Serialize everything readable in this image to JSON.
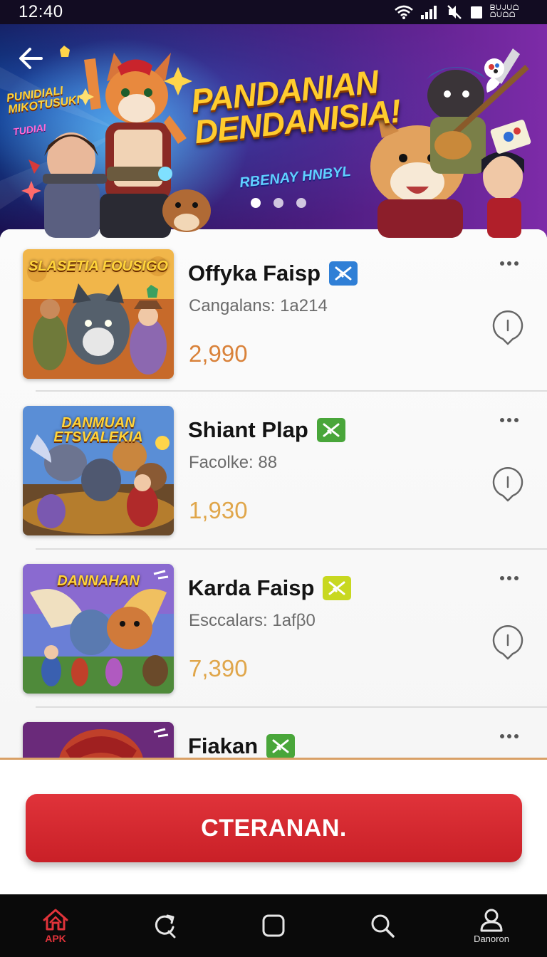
{
  "status_bar": {
    "time": "12:40",
    "indicator_text": "ᗷᑌᒍᑌᗝ ᗝᑌᗝᗝ",
    "icons": [
      "wifi-icon",
      "signal-icon",
      "mute-icon",
      "battery-icon"
    ]
  },
  "hero": {
    "title": "PANDANIAN DENDANISIA!",
    "subtitle": "RBENAY HNBYL",
    "tag_left": "PUNIDIALI MIKOTUSUKI",
    "tag_left_2": "TUDIAI",
    "page_count": 3,
    "active_page": 1,
    "back_icon": "back-arrow-icon",
    "corner_icon": "brush-icon"
  },
  "items": [
    {
      "name": "Offyka Faisp",
      "meta": "Cangalans: 1a214",
      "price": "2,990",
      "thumb_label": "SLASETIA FOUSIGO",
      "badge_color": "#2f7fd6",
      "price_color": "#d9823a"
    },
    {
      "name": "Shiant Plap",
      "meta": "Facolke: 88",
      "price": "1,930",
      "thumb_label": "DANMUAN ETSVALEKIA",
      "badge_color": "#49a63a",
      "price_color": "#e0a64a"
    },
    {
      "name": "Karda Faisp",
      "meta": "Esccalars: 1afβ0",
      "price": "7,390",
      "thumb_label": "DANNAHAN",
      "badge_color": "#c8d820",
      "price_color": "#e0a64a"
    },
    {
      "name": "Fiakan",
      "meta": "",
      "price": "",
      "thumb_label": "",
      "badge_color": "#49a63a",
      "price_color": "#e0a64a"
    }
  ],
  "cta": {
    "label": "CTERANAN."
  },
  "nav": [
    {
      "label": "APK",
      "icon": "home-icon",
      "active": true
    },
    {
      "label": "",
      "icon": "refresh-icon",
      "active": false
    },
    {
      "label": "",
      "icon": "square-icon",
      "active": false
    },
    {
      "label": "",
      "icon": "search-icon",
      "active": false
    },
    {
      "label": "Danoron",
      "icon": "profile-icon",
      "active": false
    }
  ],
  "colors": {
    "accent_red": "#d42a31",
    "divider": "#dddddd",
    "list_rule": "#d9a066"
  }
}
